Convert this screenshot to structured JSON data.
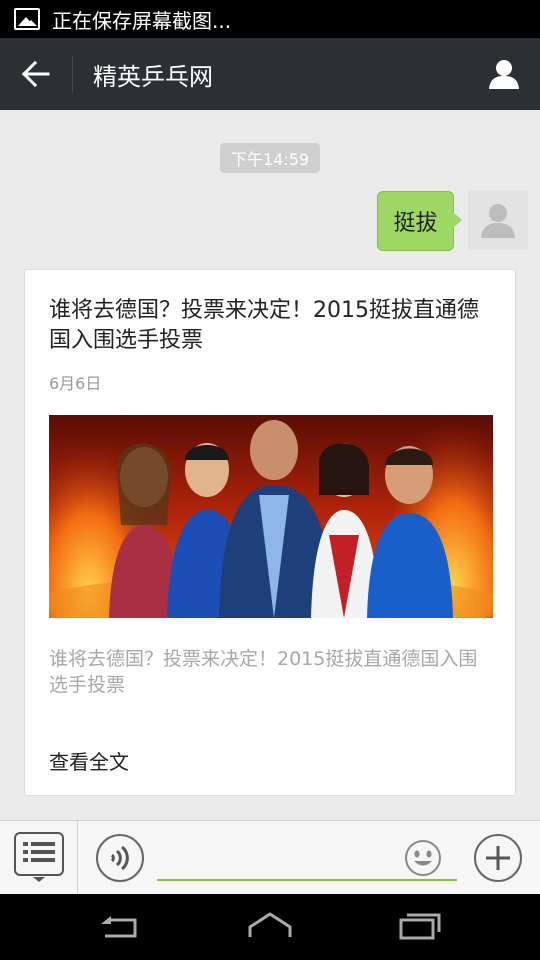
{
  "status_bar": {
    "text": "正在保存屏幕截图...",
    "icon": "image-icon"
  },
  "title_bar": {
    "title": "精英乒乓网",
    "back_icon": "arrow-left-icon",
    "profile_icon": "person-icon"
  },
  "chat": {
    "timestamp": "下午14:59",
    "sent_message": "挺拔",
    "card": {
      "title": "谁将去德国？投票来决定！2015挺拔直通德国入围选手投票",
      "date": "6月6日",
      "description": "谁将去德国？投票来决定！2015挺拔直通德国入围选手投票",
      "read_more": "查看全文"
    }
  },
  "input_bar": {
    "menu_icon": "list-menu-icon",
    "voice_icon": "voice-icon",
    "input_value": "",
    "emoji_icon": "smiley-icon",
    "add_icon": "plus-icon"
  },
  "nav_bar": {
    "back_icon": "back-icon",
    "home_icon": "home-icon",
    "recents_icon": "recents-icon"
  },
  "colors": {
    "accent_green": "#86bd4c",
    "bubble_green": "#9ed864",
    "titlebar": "#2b3033"
  }
}
